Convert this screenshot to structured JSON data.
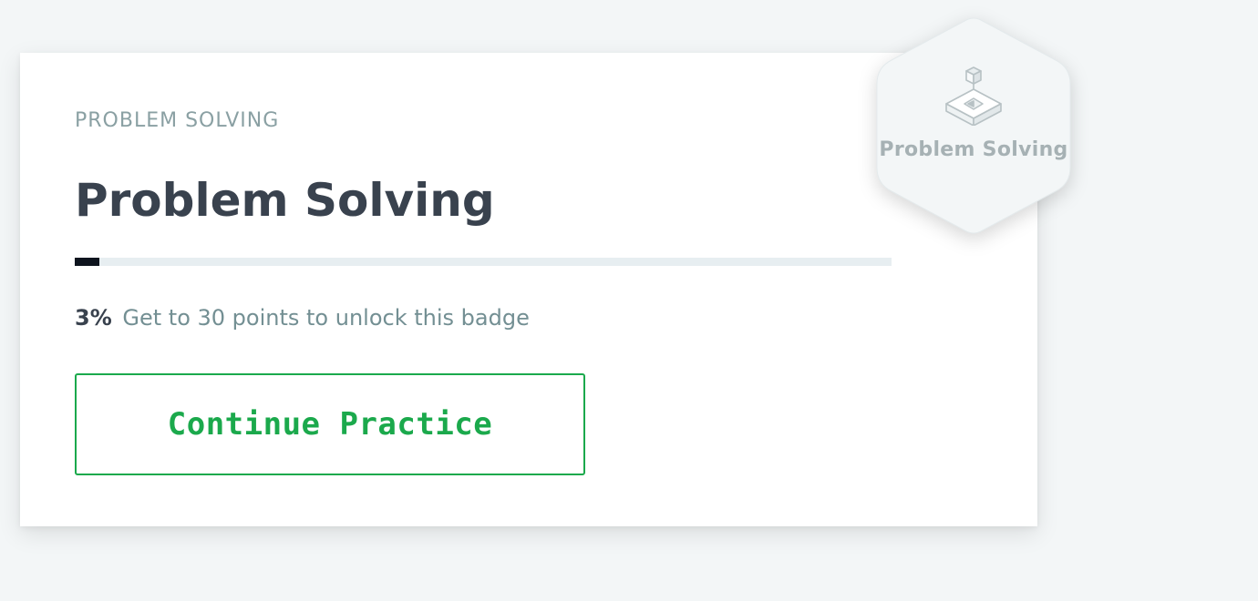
{
  "card": {
    "eyebrow": "PROBLEM SOLVING",
    "title": "Problem Solving",
    "progress_percent": 3,
    "status_percent_text": "3%",
    "status_message": "Get to 30 points to unlock this badge",
    "continue_label": "Continue Practice"
  },
  "badge": {
    "label": "Problem Solving",
    "icon": "blocks-icon",
    "state": "locked"
  },
  "colors": {
    "page_background": "#f3f6f7",
    "title": "#39424e",
    "muted_text": "#8aa0a3",
    "progress_track": "#e7eef1",
    "progress_fill": "#0e141e",
    "accent_green": "#1ba94c",
    "badge_fill": "#f3f6f7",
    "badge_text": "#a6b1b4"
  }
}
